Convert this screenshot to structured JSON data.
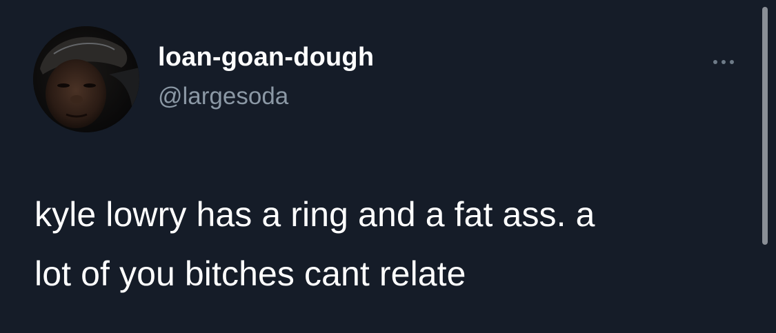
{
  "tweet": {
    "author": {
      "display_name": "loan-goan-dough",
      "handle": "@largesoda",
      "avatar_icon": "profile-photo"
    },
    "more_icon": "more-horizontal-icon",
    "text_line_1": "kyle lowry has a ring and a fat ass. a",
    "text_line_2": "lot of you bitches cant relate"
  },
  "colors": {
    "background": "#151c28",
    "primary_text": "#ffffff",
    "secondary_text": "#8b98a5"
  }
}
